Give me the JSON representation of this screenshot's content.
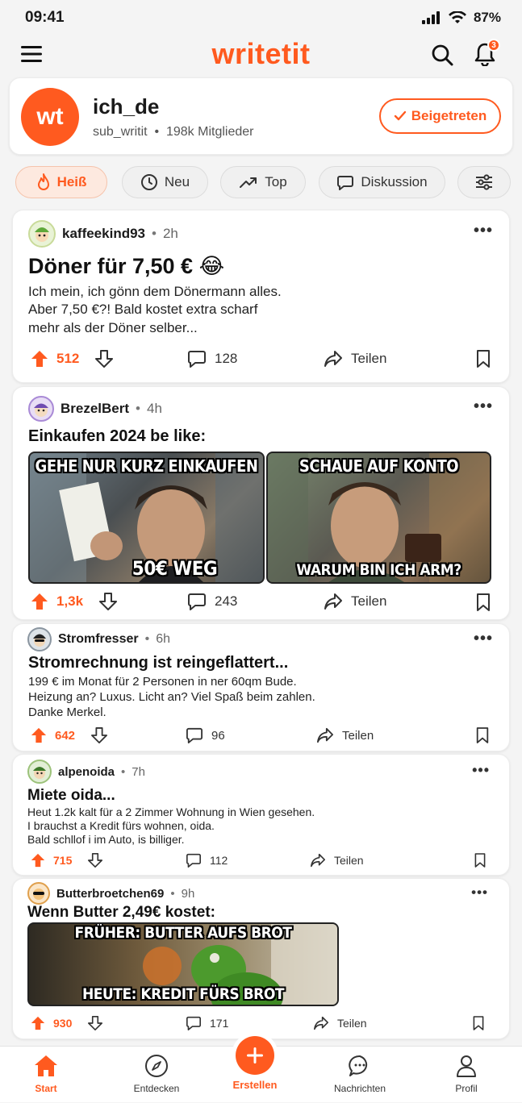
{
  "status": {
    "time": "09:41",
    "battery": "87%"
  },
  "app": {
    "logo": "writetit",
    "notif_count": "3",
    "icons": [
      "menu-icon",
      "search-icon",
      "bell-icon"
    ]
  },
  "community": {
    "avatar_text": "wt",
    "name": "ich_de",
    "sub": "sub_writit",
    "members": "198k Mitglieder",
    "joined_label": "Beigetreten"
  },
  "filters": [
    {
      "label": "Heiß",
      "icon": "flame-icon",
      "active": true
    },
    {
      "label": "Neu",
      "icon": "clock-icon"
    },
    {
      "label": "Top",
      "icon": "trend-icon"
    },
    {
      "label": "Diskussion",
      "icon": "chat-icon"
    }
  ],
  "posts": [
    {
      "user": "kaffeekind93",
      "ago": "2h",
      "title": "Döner für 7,50 € 😂",
      "body": [
        "Ich mein, ich gönn dem Dönermann alles.",
        "Aber 7,50 €?! Bald kostet extra scharf",
        "mehr als der Döner selber..."
      ],
      "upvotes": "512",
      "comments": "128",
      "share": "Teilen"
    },
    {
      "user": "BrezelBert",
      "ago": "4h",
      "title": "Einkaufen 2024 be like:",
      "meme": {
        "left_top": "GEHE NUR KURZ EINKAUFEN",
        "left_bottom": "50€ WEG",
        "right_top": "SCHAUE AUF KONTO",
        "right_bottom": "WARUM BIN ICH ARM?"
      },
      "upvotes": "1,3k",
      "comments": "243",
      "share": "Teilen"
    },
    {
      "user": "Stromfresser",
      "ago": "6h",
      "title": "Stromrechnung ist reingeflattert...",
      "body": [
        "199 € im Monat für 2 Personen in ner 60qm Bude.",
        "Heizung an? Luxus. Licht an? Viel Spaß beim zahlen.",
        "Danke Merkel."
      ],
      "upvotes": "642",
      "comments": "96",
      "share": "Teilen"
    },
    {
      "user": "alpenoida",
      "ago": "7h",
      "title": "Miete oida...",
      "body": [
        "Heut 1.2k kalt für a 2 Zimmer Wohnung in Wien gesehen.",
        "I brauchst a Kredit fürs wohnen, oida.",
        "Bald schllof i im Auto, is billiger."
      ],
      "upvotes": "715",
      "comments": "112",
      "share": "Teilen"
    },
    {
      "user": "Butterbroetchen69",
      "ago": "9h",
      "title": "Wenn Butter 2,49€ kostet:",
      "meme": {
        "top": "FRÜHER: BUTTER AUFS BROT",
        "bottom": "HEUTE: KREDIT FÜRS BROT"
      },
      "upvotes": "930",
      "comments": "171",
      "share": "Teilen"
    }
  ],
  "tabs": [
    {
      "label": "Start",
      "icon": "home-icon",
      "active": true
    },
    {
      "label": "Entdecken",
      "icon": "compass-icon"
    },
    {
      "label": "Erstellen",
      "icon": "plus-icon"
    },
    {
      "label": "Nachrichten",
      "icon": "message-icon"
    },
    {
      "label": "Profil",
      "icon": "profile-icon"
    }
  ],
  "colors": {
    "accent": "#ff5a1f"
  }
}
